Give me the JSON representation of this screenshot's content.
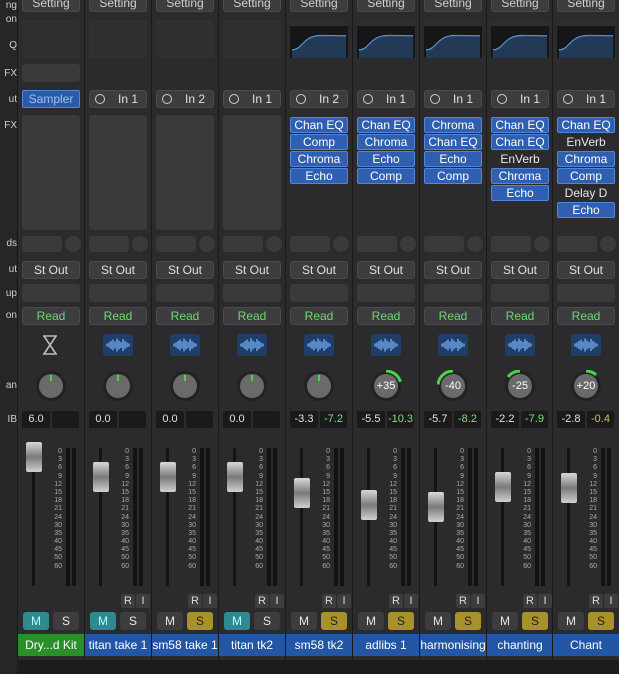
{
  "row_labels": [
    "ng",
    "on",
    "Q",
    "FX",
    "ut",
    "FX",
    "ds",
    "ut",
    "up",
    "on",
    "an",
    "IB"
  ],
  "common": {
    "setting": "Setting",
    "output": "St Out",
    "automation": "Read",
    "mute": "M",
    "solo": "S",
    "record": "R",
    "input_monitor": "I"
  },
  "strips": [
    {
      "name": "Dry...d Kit",
      "input": "Sampler",
      "plugins": [],
      "volume": "6.0",
      "peak": "",
      "pan": "",
      "name_color": "#2a8f2a",
      "mute_on": true,
      "solo_on": false,
      "has_eq": false,
      "has_ri": false,
      "fader": 0.05
    },
    {
      "name": "titan take 1",
      "input": "In 1",
      "plugins": [],
      "volume": "0.0",
      "peak": "",
      "pan": "",
      "mute_on": true,
      "solo_on": false,
      "has_eq": false,
      "has_ri": true,
      "fader": 0.22
    },
    {
      "name": "sm58 take 1",
      "input": "In 2",
      "plugins": [],
      "volume": "0.0",
      "peak": "",
      "pan": "",
      "mute_on": false,
      "solo_on": true,
      "has_eq": false,
      "has_ri": true,
      "fader": 0.22
    },
    {
      "name": "titan tk2",
      "input": "In 1",
      "plugins": [],
      "volume": "0.0",
      "peak": "",
      "pan": "",
      "mute_on": true,
      "solo_on": false,
      "has_eq": false,
      "has_ri": true,
      "fader": 0.22
    },
    {
      "name": "sm58 tk2",
      "input": "In 2",
      "plugins": [
        "Chan EQ",
        "Comp",
        "Chroma",
        "Echo"
      ],
      "volume": "-3.3",
      "peak": "-7.2",
      "peak_color": "#7ee07e",
      "pan": "",
      "mute_on": false,
      "solo_on": true,
      "has_eq": true,
      "has_ri": true,
      "fader": 0.35
    },
    {
      "name": "adlibs 1",
      "input": "In 1",
      "plugins": [
        "Chan EQ",
        "Chroma",
        "Echo",
        "Comp"
      ],
      "volume": "-5.5",
      "peak": "-10.3",
      "peak_color": "#7ee07e",
      "pan": "+35",
      "mute_on": false,
      "solo_on": true,
      "has_eq": true,
      "has_ri": true,
      "fader": 0.45
    },
    {
      "name": "harmonising",
      "input": "In 1",
      "plugins": [
        "Chroma",
        "Chan EQ",
        "Echo",
        "Comp"
      ],
      "volume": "-5.7",
      "peak": "-8.2",
      "peak_color": "#7ee07e",
      "pan": "-40",
      "mute_on": false,
      "solo_on": true,
      "has_eq": true,
      "has_ri": true,
      "fader": 0.47
    },
    {
      "name": "chanting",
      "input": "In 1",
      "plugins": [
        "Chan EQ",
        "Chan EQ",
        "EnVerb",
        "Chroma",
        "Echo"
      ],
      "plugins_on": [
        true,
        true,
        false,
        true,
        true
      ],
      "volume": "-2.2",
      "peak": "-7.9",
      "peak_color": "#7ee07e",
      "pan": "-25",
      "mute_on": false,
      "solo_on": true,
      "has_eq": true,
      "has_ri": true,
      "fader": 0.3
    },
    {
      "name": "Chant",
      "input": "In 1",
      "plugins": [
        "Chan EQ",
        "EnVerb",
        "Chroma",
        "Comp",
        "Delay D",
        "Echo"
      ],
      "plugins_on": [
        true,
        false,
        true,
        true,
        false,
        true
      ],
      "volume": "-2.8",
      "peak": "-0.4",
      "peak_color": "#e0c040",
      "pan": "+20",
      "mute_on": false,
      "solo_on": true,
      "has_eq": true,
      "has_ri": true,
      "fader": 0.31
    }
  ],
  "scale_marks": [
    "0",
    "3",
    "6",
    "9",
    "12",
    "15",
    "18",
    "21",
    "24",
    "30",
    "35",
    "40",
    "45",
    "50",
    "60"
  ]
}
